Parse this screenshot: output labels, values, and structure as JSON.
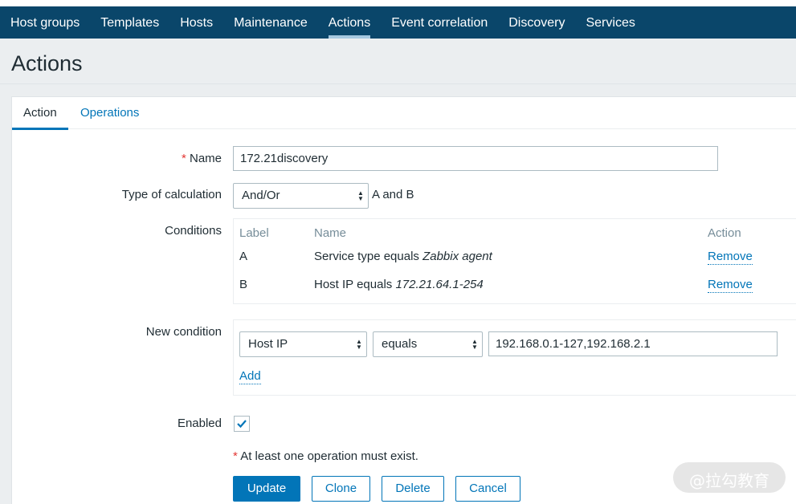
{
  "nav": {
    "items": [
      "Host groups",
      "Templates",
      "Hosts",
      "Maintenance",
      "Actions",
      "Event correlation",
      "Discovery",
      "Services"
    ],
    "active": "Actions"
  },
  "page": {
    "title": "Actions"
  },
  "tabs": {
    "action": "Action",
    "operations": "Operations"
  },
  "form": {
    "name_label": "Name",
    "name_required_mark": "*",
    "name_value": "172.21discovery",
    "calc_label": "Type of calculation",
    "calc_value": "And/Or",
    "calc_formula": "A and B",
    "conditions_label": "Conditions",
    "conditions": {
      "headers": {
        "label": "Label",
        "name": "Name",
        "action": "Action"
      },
      "rows": [
        {
          "label": "A",
          "name_prefix": "Service type equals ",
          "name_value": "Zabbix agent",
          "action": "Remove"
        },
        {
          "label": "B",
          "name_prefix": "Host IP equals ",
          "name_value": "172.21.64.1-254",
          "action": "Remove"
        }
      ]
    },
    "new_condition_label": "New condition",
    "new_condition": {
      "type": "Host IP",
      "operator": "equals",
      "value": "192.168.0.1-127,192.168.2.1",
      "add": "Add"
    },
    "enabled_label": "Enabled",
    "enabled": true,
    "note_mark": "*",
    "note": "At least one operation must exist."
  },
  "buttons": {
    "update": "Update",
    "clone": "Clone",
    "delete": "Delete",
    "cancel": "Cancel"
  },
  "watermark": "@拉勾教育",
  "colors": {
    "nav_bg": "#0a466a",
    "accent": "#0275b8",
    "required": "#e33734"
  }
}
